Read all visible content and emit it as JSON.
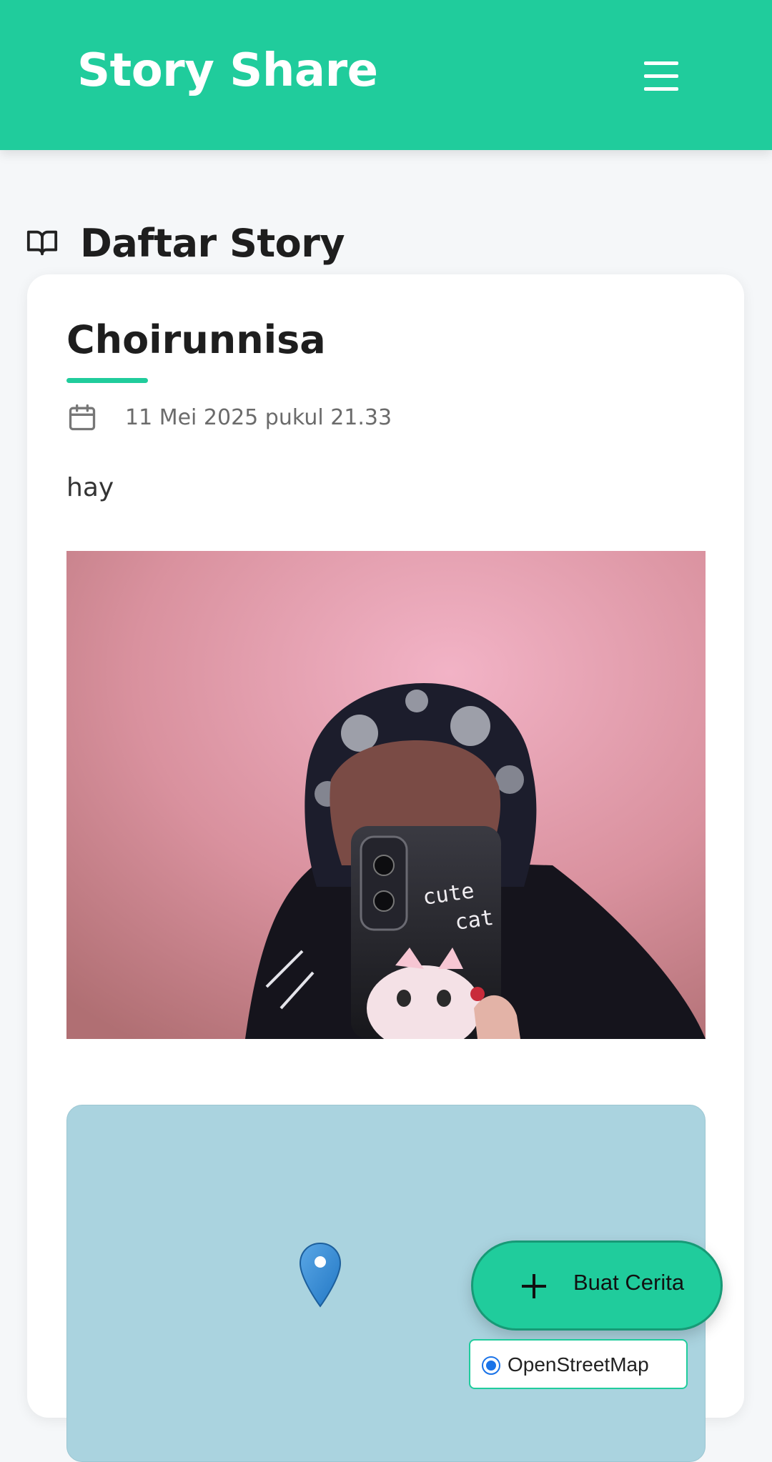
{
  "header": {
    "brand": "Story Share",
    "menu_icon": "hamburger-menu-icon",
    "background": "#20cc9c"
  },
  "page": {
    "section_icon": "open-book-icon",
    "section_title": "Daftar Story"
  },
  "stories": [
    {
      "author": "Choirunnisa",
      "date_icon": "calendar-icon",
      "date": "11 Mei 2025 pukul 21.33",
      "description": "hay",
      "photo_text": [
        "cute",
        "cat"
      ],
      "map": {
        "marker_icon": "map-marker-icon",
        "layer_option": "OpenStreetMap"
      }
    }
  ],
  "fab": {
    "icon": "plus-icon",
    "label": "Buat Cerita"
  },
  "colors": {
    "accent": "#20cc9c",
    "page_background": "#f5f7f9",
    "map_water": "#aad3df"
  }
}
